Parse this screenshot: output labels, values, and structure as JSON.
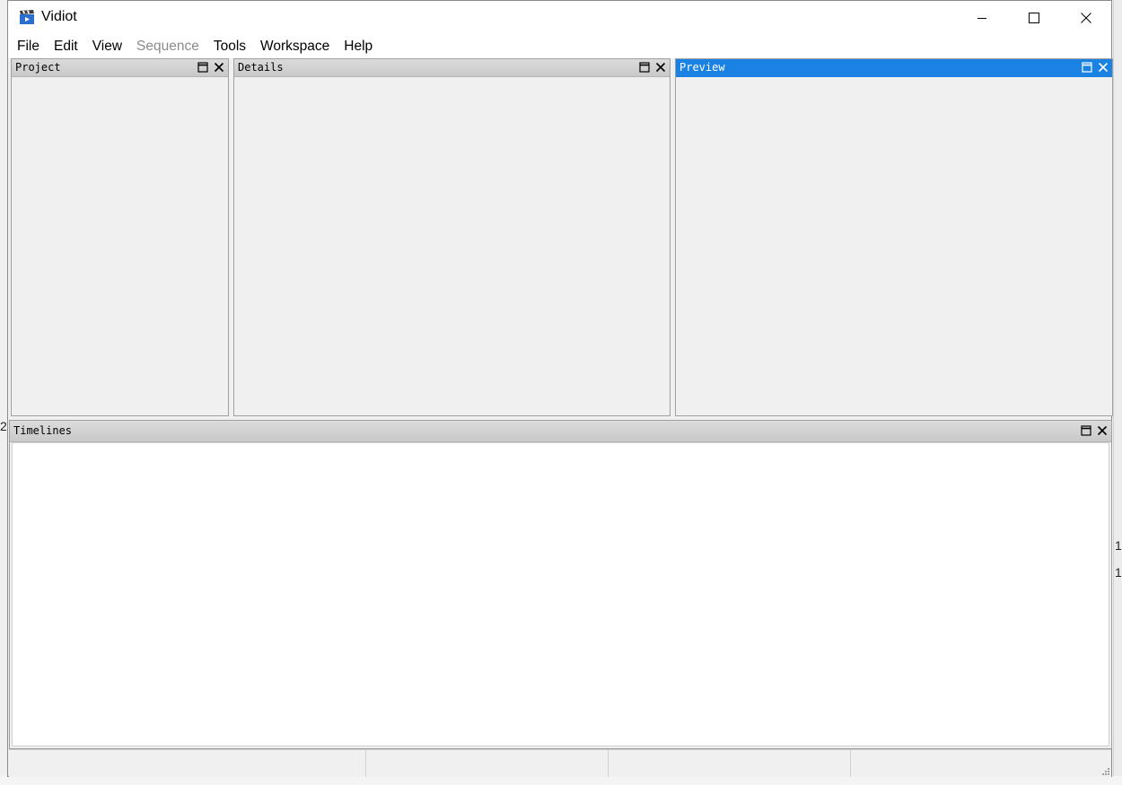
{
  "window": {
    "title": "Vidiot"
  },
  "menu": {
    "items": [
      {
        "label": "File",
        "enabled": true
      },
      {
        "label": "Edit",
        "enabled": true
      },
      {
        "label": "View",
        "enabled": true
      },
      {
        "label": "Sequence",
        "enabled": false
      },
      {
        "label": "Tools",
        "enabled": true
      },
      {
        "label": "Workspace",
        "enabled": true
      },
      {
        "label": "Help",
        "enabled": true
      }
    ]
  },
  "panes": {
    "project": {
      "title": "Project"
    },
    "details": {
      "title": "Details"
    },
    "preview": {
      "title": "Preview",
      "active": true
    },
    "timelines": {
      "title": "Timelines"
    }
  },
  "background_fragments": {
    "left_number": "2.",
    "right_digit_1": "1",
    "right_digit_2": "1"
  },
  "colors": {
    "active_caption": "#1a82e2",
    "caption": "#d3d3d3",
    "window_bg": "#f0f0f0"
  },
  "icons": {
    "app": "clapperboard-icon",
    "pane_float": "float-pane-icon",
    "pane_close": "close-icon"
  }
}
